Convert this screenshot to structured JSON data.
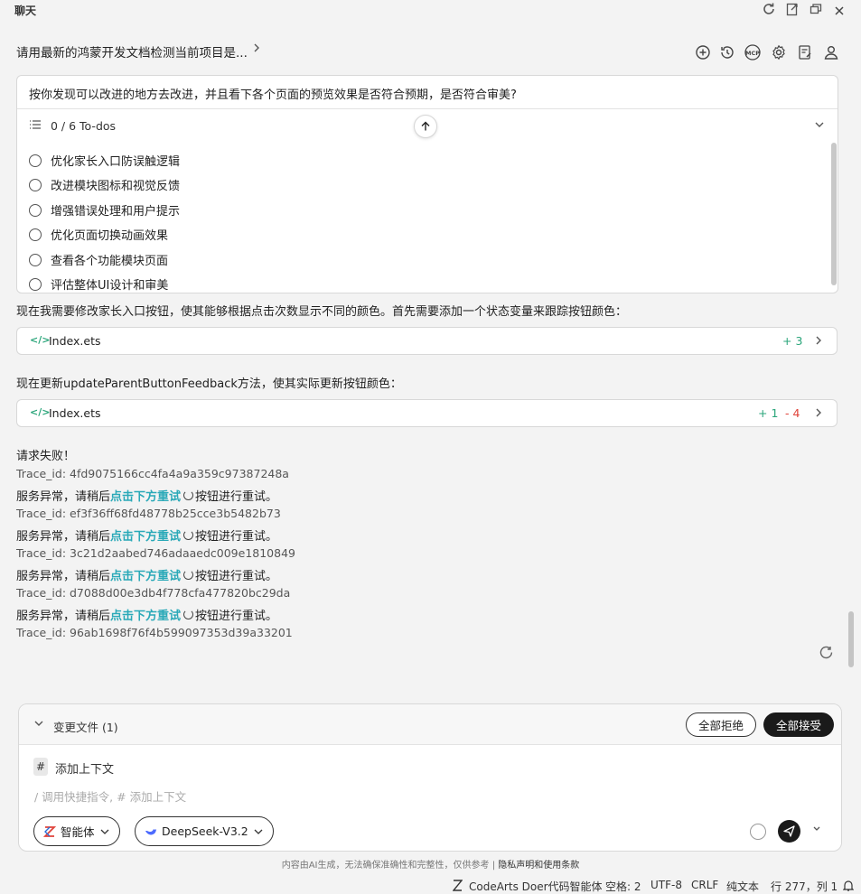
{
  "titlebar": {
    "title": "聊天"
  },
  "header": {
    "conversation_title": "请用最新的鸿蒙开发文档检测当前项目是..."
  },
  "todo_panel": {
    "question": "按你发现可以改进的地方去改进，并且看下各个页面的预览效果是否符合预期，是否符合审美?",
    "progress": "0 / 6 To-dos",
    "items": [
      "优化家长入口防误触逻辑",
      "改进模块图标和视觉反馈",
      "增强错误处理和用户提示",
      "优化页面切换动画效果",
      "查看各个功能模块页面",
      "评估整体UI设计和审美"
    ]
  },
  "messages": {
    "msg1": "现在我需要修改家长入口按钮，使其能够根据点击次数显示不同的颜色。首先需要添加一个状态变量来跟踪按钮颜色：",
    "file1": {
      "name": "Index.ets",
      "added": "+ 3",
      "removed": ""
    },
    "msg2": "现在更新updateParentButtonFeedback方法，使其实际更新按钮颜色：",
    "file2": {
      "name": "Index.ets",
      "added": "+ 1",
      "removed": "- 4"
    }
  },
  "errors": {
    "title": "请求失败！",
    "service_prefix": "服务异常，请稍后",
    "service_link": "点击下方重试",
    "service_suffix": "按钮进行重试。",
    "traces": [
      "Trace_id: 4fd9075166cc4fa4a9a359c97387248a",
      "Trace_id: ef3f36ff68fd48778b25cce3b5482b73",
      "Trace_id: 3c21d2aabed746adaaedc009e1810849",
      "Trace_id: d7088d00e3db4f778cfa477820bc29da",
      "Trace_id: 96ab1698f76f4b599097353d39a33201"
    ]
  },
  "input": {
    "changes_label": "变更文件 (1)",
    "reject_all": "全部拒绝",
    "accept_all": "全部接受",
    "hash": "#",
    "add_context": "添加上下文",
    "placeholder": "/ 调用快捷指令, # 添加上下文",
    "agent_label": "智能体",
    "model_label": "DeepSeek-V3.2"
  },
  "disclaimer": {
    "text": "内容由AI生成，无法确保准确性和完整性，仅供参考",
    "separator": "|",
    "link": "隐私声明和使用条款"
  },
  "statusbar": {
    "agent": "CodeArts Doer代码智能体",
    "spaces": "空格: 2",
    "encoding": "UTF-8",
    "eol": "CRLF",
    "language": "纯文本",
    "position": "行 277，列 1"
  },
  "colors": {
    "accent_link": "#2aa9b8",
    "added": "#2aa57a",
    "removed": "#e0433a",
    "button_dark": "#1a1a1a"
  }
}
